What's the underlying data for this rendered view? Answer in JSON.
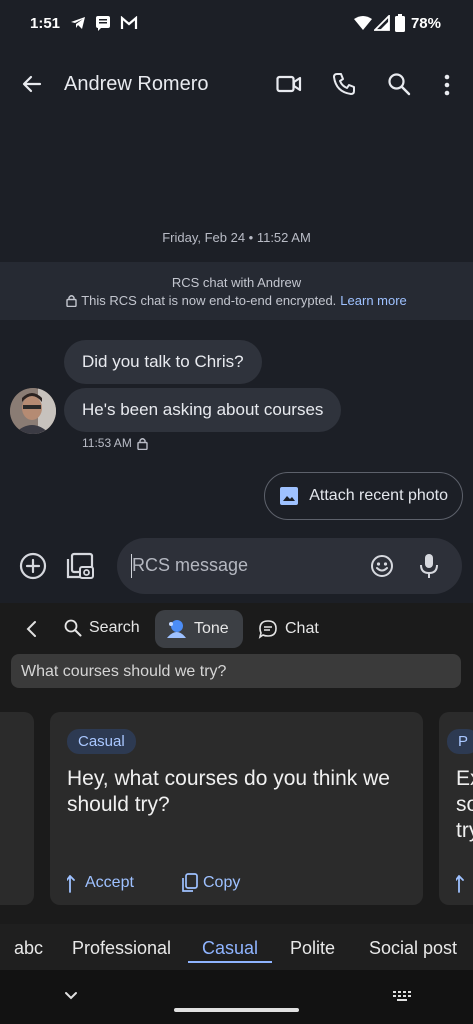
{
  "status_bar": {
    "time": "1:51",
    "battery": "78%"
  },
  "header": {
    "title": "Andrew Romero"
  },
  "conversation": {
    "timestamp": "Friday, Feb 24 • 11:52 AM",
    "rcs_title": "RCS chat with Andrew",
    "rcs_note": "This RCS chat is now end-to-end encrypted.",
    "rcs_link": "Learn more",
    "messages": [
      {
        "text": "Did you talk to Chris?"
      },
      {
        "text": "He's been asking about courses"
      }
    ],
    "message_time": "11:53 AM",
    "attach_label": "Attach recent photo"
  },
  "compose": {
    "placeholder": "RCS message"
  },
  "keyboard_toolbar": {
    "search": "Search",
    "tone": "Tone",
    "chat": "Chat",
    "query": "What courses should we try?"
  },
  "suggestion_cards": [
    {
      "chip": "Casual",
      "text": "Hey, what courses do you think we should try?",
      "accept": "Accept",
      "copy": "Copy"
    }
  ],
  "partial_card": {
    "chip": "P",
    "lines": [
      "Ex",
      "so",
      "try"
    ]
  },
  "tone_tabs": [
    "abc",
    "Professional",
    "Casual",
    "Polite",
    "Social post"
  ],
  "active_tab": "Casual",
  "colors": {
    "accent": "#8fb4ff",
    "link": "#9ec1ff"
  }
}
